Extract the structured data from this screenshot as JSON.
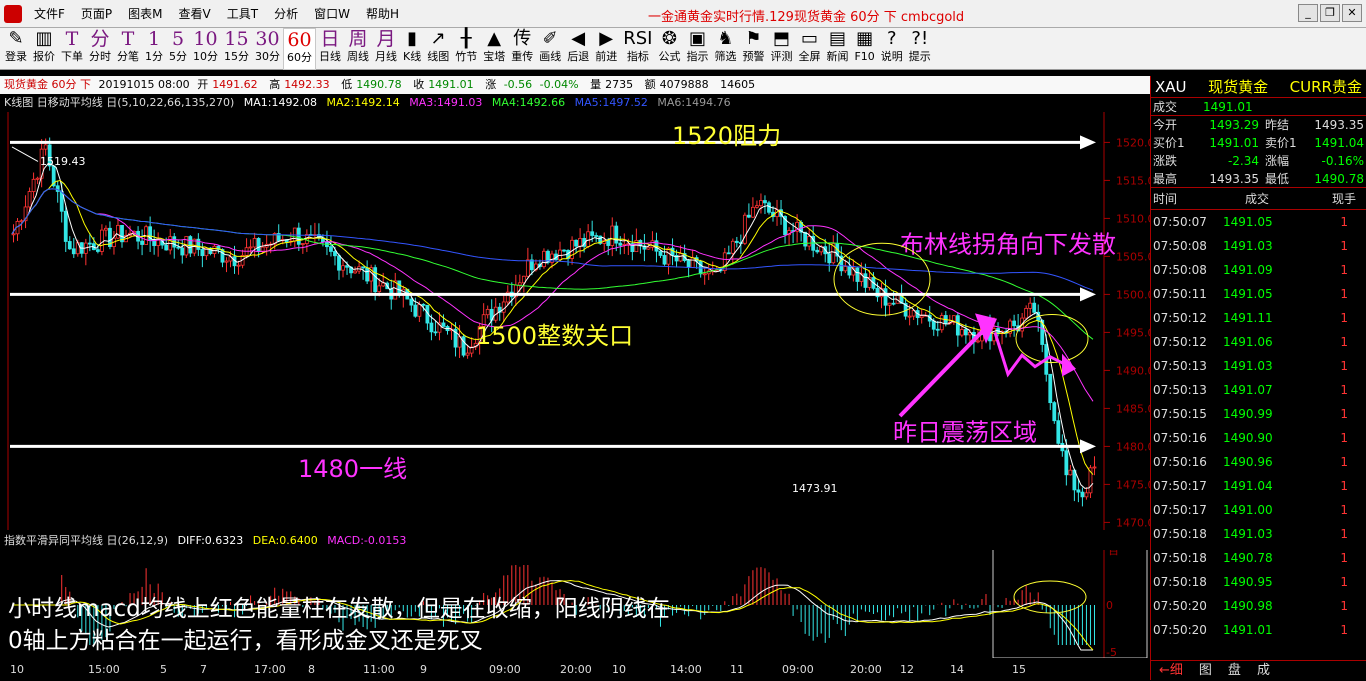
{
  "titlebar": {
    "menus": [
      "文件F",
      "页面P",
      "图表M",
      "查看V",
      "工具T",
      "分析",
      "窗口W",
      "帮助H"
    ],
    "window_title": "一金通黄金实时行情.129现货黄金 60分 下 cmbcgold"
  },
  "toolbar": [
    {
      "icon": "✎",
      "label": "登录"
    },
    {
      "icon": "▥",
      "label": "报价"
    },
    {
      "icon": "T",
      "label": "下单",
      "big": true
    },
    {
      "icon": "分",
      "label": "分时",
      "big": true
    },
    {
      "icon": "T",
      "label": "分笔",
      "big": true
    },
    {
      "icon": "1",
      "label": "1分",
      "big": true
    },
    {
      "icon": "5",
      "label": "5分",
      "big": true
    },
    {
      "icon": "10",
      "label": "10分",
      "big": true
    },
    {
      "icon": "15",
      "label": "15分",
      "big": true
    },
    {
      "icon": "30",
      "label": "30分",
      "big": true
    },
    {
      "icon": "60",
      "label": "60分",
      "big": true,
      "sel": true
    },
    {
      "icon": "日",
      "label": "日线",
      "big": true
    },
    {
      "icon": "周",
      "label": "周线",
      "big": true
    },
    {
      "icon": "月",
      "label": "月线",
      "big": true
    },
    {
      "icon": "▮",
      "label": "K线"
    },
    {
      "icon": "↗",
      "label": "线图"
    },
    {
      "icon": "╂",
      "label": "竹节"
    },
    {
      "icon": "▲",
      "label": "宝塔"
    },
    {
      "icon": "传",
      "label": "重传"
    },
    {
      "icon": "✐",
      "label": "画线"
    },
    {
      "icon": "◀",
      "label": "后退"
    },
    {
      "icon": "▶",
      "label": "前进"
    },
    {
      "icon": "RSI",
      "label": "指标"
    },
    {
      "icon": "❂",
      "label": "公式"
    },
    {
      "icon": "▣",
      "label": "指示"
    },
    {
      "icon": "♞",
      "label": "筛选"
    },
    {
      "icon": "⚑",
      "label": "预警"
    },
    {
      "icon": "⬒",
      "label": "评测"
    },
    {
      "icon": "▭",
      "label": "全屏"
    },
    {
      "icon": "▤",
      "label": "新闻"
    },
    {
      "icon": "▦",
      "label": "F10"
    },
    {
      "icon": "?",
      "label": "说明"
    },
    {
      "icon": "?!",
      "label": "提示"
    }
  ],
  "infobar": {
    "name": "现货黄金 60分 下",
    "date": "20191015 08:00",
    "open_label": "开",
    "open": "1491.62",
    "high_label": "高",
    "high": "1492.33",
    "low_label": "低",
    "low": "1490.78",
    "close_label": "收",
    "close": "1491.01",
    "chg_label": "涨",
    "chg": "-0.56",
    "chg_pct": "-0.04%",
    "vol_label": "量",
    "vol": "2735",
    "amt_label": "额",
    "amt": "4079888",
    "oi": "14605"
  },
  "mabar": {
    "title": "K线图 日移动平均线 日(5,10,22,66,135,270)",
    "ma1": "MA1:1492.08",
    "ma2": "MA2:1492.14",
    "ma3": "MA3:1491.03",
    "ma4": "MA4:1492.66",
    "ma5": "MA5:1497.52",
    "ma6": "MA6:1494.76"
  },
  "chart_data": {
    "type": "candlestick",
    "y_ticks": [
      "1520.0",
      "1515.0",
      "1510.0",
      "1505.0",
      "1500.0",
      "1495.0",
      "1490.0",
      "1485.0",
      "1480.0",
      "1475.0",
      "1470.0"
    ],
    "ylim": [
      1469,
      1524
    ],
    "annotations": {
      "max_label": "1519.43",
      "min_label": "1473.91",
      "resist": "1520阻力",
      "key": "1500整数关口",
      "support": "1480一线",
      "bollinger": "布林线拐角向下发散",
      "range": "昨日震荡区域"
    },
    "colors": {
      "up": "#ff3333",
      "down": "#33e6e6",
      "ma1": "#ffffff",
      "ma2": "#ffff00",
      "ma3": "#ff33ff",
      "ma4": "#33ff33",
      "ma5": "#3355ff",
      "ma6": "#999999",
      "annot_yellow": "#ffff33",
      "annot_magenta": "#ff33ff"
    }
  },
  "macd": {
    "title": "指数平滑异同平均线 日(26,12,9)",
    "diff": "DIFF:0.6323",
    "dea": "DEA:0.6400",
    "macd": "MACD:-0.0153",
    "y_top": "百",
    "y_zero": "0",
    "y_bottom": "-5",
    "comment_line1": "小时线macd均线上红色能量柱在发散，但是在收缩，阳线阴线在",
    "comment_line2": "0轴上方粘合在一起运行，看形成金叉还是死叉"
  },
  "time_axis": [
    "10",
    "15:00",
    "5",
    "7",
    "17:00",
    "8",
    "11:00",
    "9",
    "09:00",
    "20:00",
    "10",
    "14:00",
    "11",
    "09:00",
    "20:00",
    "12",
    "14",
    "15"
  ],
  "quote": {
    "code": "XAU",
    "name": "现货黄金",
    "market": "CURR贵金",
    "last_label": "成交",
    "last": "1491.01",
    "open_label": "今开",
    "open": "1493.29",
    "prev_label": "昨结",
    "prev": "1493.35",
    "bid_label": "买价1",
    "bid": "1491.01",
    "ask_label": "卖价1",
    "ask": "1491.04",
    "chg_label": "涨跌",
    "chg": "-2.34",
    "pct_label": "涨幅",
    "pct": "-0.16%",
    "high_label": "最高",
    "high": "1493.35",
    "low_label": "最低",
    "low": "1490.78"
  },
  "ticks_header": {
    "time": "时间",
    "price": "成交",
    "vol": "现手"
  },
  "ticks": [
    {
      "t": "07:50:07",
      "p": "1491.05",
      "v": "1",
      "up": false
    },
    {
      "t": "07:50:08",
      "p": "1491.03",
      "v": "1",
      "up": false
    },
    {
      "t": "07:50:08",
      "p": "1491.09",
      "v": "1",
      "up": false
    },
    {
      "t": "07:50:11",
      "p": "1491.05",
      "v": "1",
      "up": false
    },
    {
      "t": "07:50:12",
      "p": "1491.11",
      "v": "1",
      "up": false
    },
    {
      "t": "07:50:12",
      "p": "1491.06",
      "v": "1",
      "up": false
    },
    {
      "t": "07:50:13",
      "p": "1491.03",
      "v": "1",
      "up": false
    },
    {
      "t": "07:50:13",
      "p": "1491.07",
      "v": "1",
      "up": false
    },
    {
      "t": "07:50:15",
      "p": "1490.99",
      "v": "1",
      "up": false
    },
    {
      "t": "07:50:16",
      "p": "1490.90",
      "v": "1",
      "up": false
    },
    {
      "t": "07:50:16",
      "p": "1490.96",
      "v": "1",
      "up": false
    },
    {
      "t": "07:50:17",
      "p": "1491.04",
      "v": "1",
      "up": false
    },
    {
      "t": "07:50:17",
      "p": "1491.00",
      "v": "1",
      "up": false
    },
    {
      "t": "07:50:18",
      "p": "1491.03",
      "v": "1",
      "up": false
    },
    {
      "t": "07:50:18",
      "p": "1490.78",
      "v": "1",
      "up": false
    },
    {
      "t": "07:50:18",
      "p": "1490.95",
      "v": "1",
      "up": false
    },
    {
      "t": "07:50:20",
      "p": "1490.98",
      "v": "1",
      "up": false
    },
    {
      "t": "07:50:20",
      "p": "1491.01",
      "v": "1",
      "up": false
    }
  ],
  "tabs": [
    "细",
    "图",
    "盘",
    "成"
  ]
}
